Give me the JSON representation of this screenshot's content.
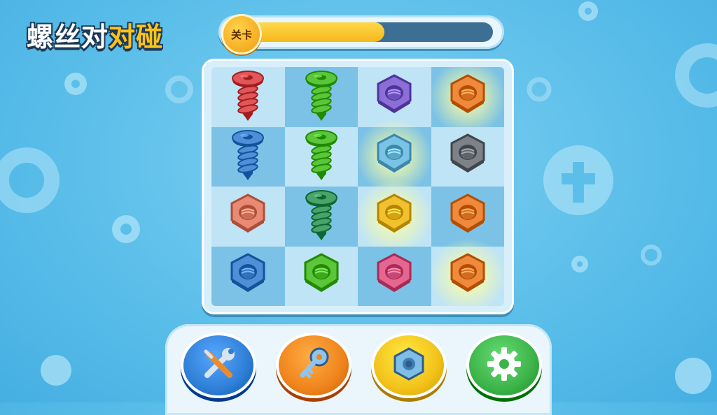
{
  "game": {
    "title_part1": "螺丝对",
    "title_part2": "对碰"
  },
  "level": {
    "label": "关卡",
    "progress": 0.56
  },
  "board": {
    "rows": [
      [
        {
          "item": "screw",
          "color": "red",
          "glow": false
        },
        {
          "item": "screw",
          "color": "green",
          "glow": false
        },
        {
          "item": "nut",
          "color": "purple",
          "glow": false
        },
        {
          "item": "nut",
          "color": "orange",
          "glow": true
        }
      ],
      [
        {
          "item": "screw",
          "color": "blue",
          "glow": false
        },
        {
          "item": "screw",
          "color": "green",
          "glow": false
        },
        {
          "item": "nut",
          "color": "lightblue",
          "glow": true
        },
        {
          "item": "nut",
          "color": "gray",
          "glow": false
        }
      ],
      [
        {
          "item": "nut",
          "color": "salmon",
          "glow": false
        },
        {
          "item": "screw",
          "color": "darkgreen",
          "glow": false
        },
        {
          "item": "nut",
          "color": "yellow",
          "glow": true
        },
        {
          "item": "nut",
          "color": "orange",
          "glow": false
        }
      ],
      [
        {
          "item": "nut",
          "color": "blue",
          "glow": false
        },
        {
          "item": "nut",
          "color": "green",
          "glow": false
        },
        {
          "item": "nut",
          "color": "pink",
          "glow": false
        },
        {
          "item": "nut",
          "color": "orange",
          "glow": true
        }
      ]
    ]
  },
  "toolbar": {
    "buttons": [
      {
        "name": "tools-button",
        "icon": "wrench-screwdriver-icon",
        "bg": "#2f7fd6"
      },
      {
        "name": "key-button",
        "icon": "key-icon",
        "bg": "#f0841c"
      },
      {
        "name": "nut-button",
        "icon": "nut-icon",
        "bg": "#f2c21a"
      },
      {
        "name": "settings-button",
        "icon": "gear-icon",
        "bg": "#3db44a"
      }
    ]
  },
  "colors": {
    "red": "#e0575a",
    "green": "#5cc63a",
    "purple": "#8b6fd6",
    "orange": "#ef8a3c",
    "blue": "#4f8fd8",
    "lightblue": "#79c3e6",
    "gray": "#7d8288",
    "salmon": "#e98b74",
    "darkgreen": "#4aa36a",
    "yellow": "#f2c130",
    "pink": "#e56791"
  }
}
